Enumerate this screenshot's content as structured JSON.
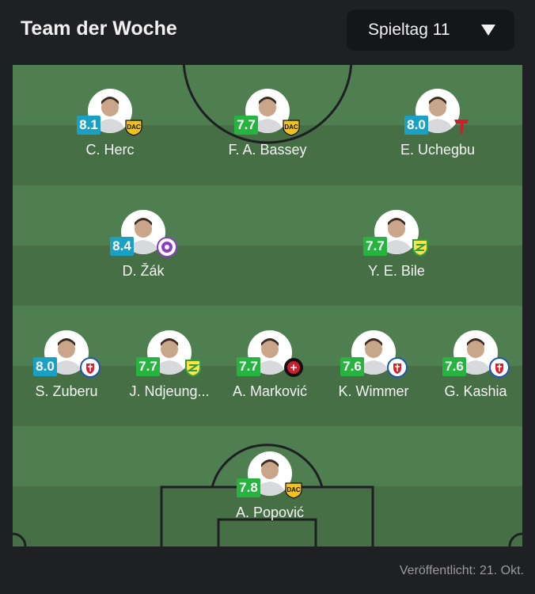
{
  "header": {
    "title": "Team der Woche"
  },
  "round_select": {
    "value": "Spieltag 11"
  },
  "colors": {
    "rating_blue": "#1aa0c2",
    "rating_green": "#27b33f",
    "pitch_light": "#4f7f51",
    "pitch_dark": "#446f45"
  },
  "players": [
    {
      "name": "C. Herc",
      "rating": "8.1",
      "rating_color": "blue",
      "club": "dac-badge"
    },
    {
      "name": "F. A. Bassey",
      "rating": "7.7",
      "rating_color": "green",
      "club": "dac-badge"
    },
    {
      "name": "E. Uchegbu",
      "rating": "8.0",
      "rating_color": "blue",
      "club": "trencin-badge"
    },
    {
      "name": "D. Žák",
      "rating": "8.4",
      "rating_color": "blue",
      "club": "komarno-badge"
    },
    {
      "name": "Y. E. Bile",
      "rating": "7.7",
      "rating_color": "green",
      "club": "zilina-badge"
    },
    {
      "name": "S. Zuberu",
      "rating": "8.0",
      "rating_color": "blue",
      "club": "slovan-badge"
    },
    {
      "name": "J. Ndjeung...",
      "rating": "7.7",
      "rating_color": "green",
      "club": "zilina-badge"
    },
    {
      "name": "A. Marković",
      "rating": "7.7",
      "rating_color": "green",
      "club": "podbrezova-badge"
    },
    {
      "name": "K. Wimmer",
      "rating": "7.6",
      "rating_color": "green",
      "club": "slovan-badge"
    },
    {
      "name": "G. Kashia",
      "rating": "7.6",
      "rating_color": "green",
      "club": "slovan-badge"
    },
    {
      "name": "A. Popović",
      "rating": "7.8",
      "rating_color": "green",
      "club": "dac-badge"
    }
  ],
  "footer": {
    "published": "Veröffentlicht: 21. Okt."
  }
}
